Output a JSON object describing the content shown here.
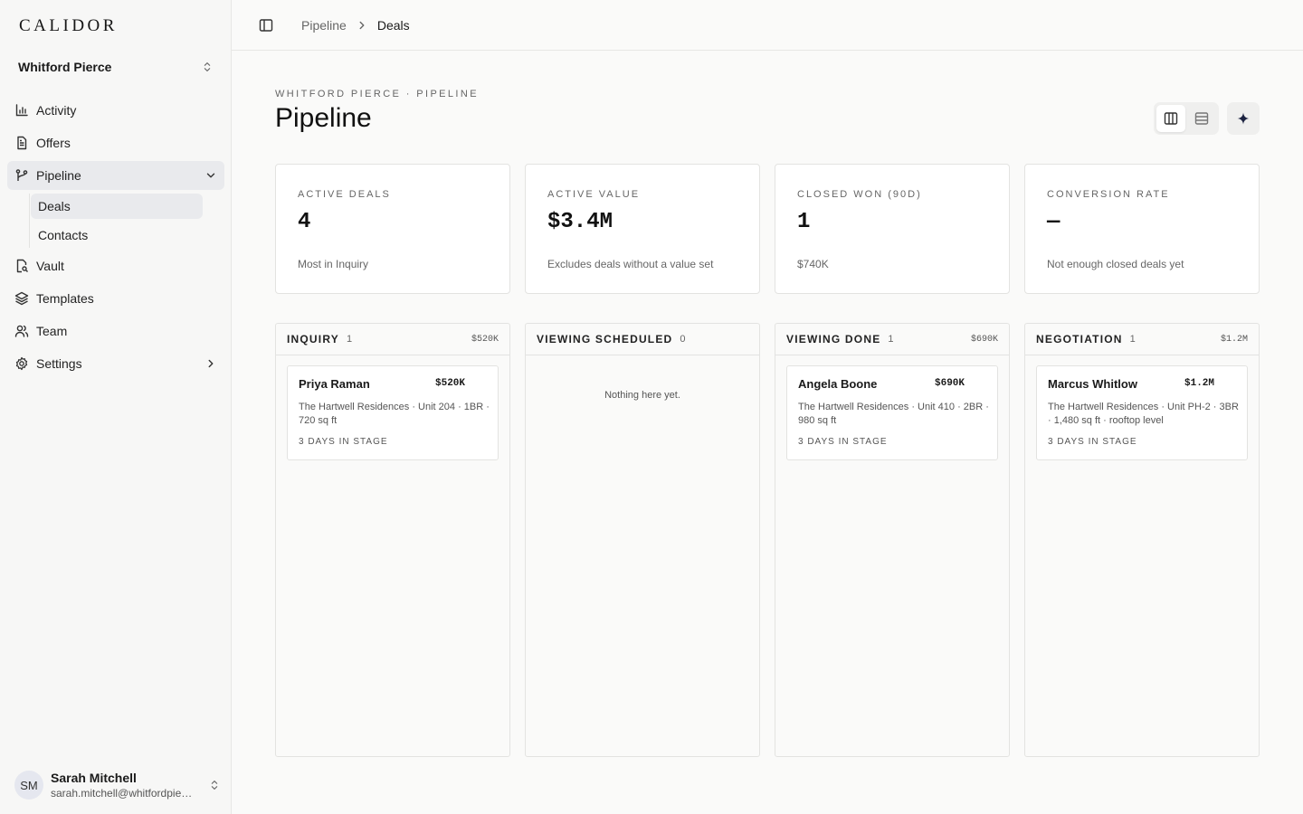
{
  "app": {
    "logo": "CALIDOR"
  },
  "sidebar": {
    "org": "Whitford Pierce",
    "items": [
      {
        "label": "Activity",
        "icon": "bar-chart-icon"
      },
      {
        "label": "Offers",
        "icon": "document-icon"
      },
      {
        "label": "Pipeline",
        "icon": "branch-icon",
        "expanded": true,
        "children": [
          {
            "label": "Deals",
            "active": true
          },
          {
            "label": "Contacts"
          }
        ]
      },
      {
        "label": "Vault",
        "icon": "file-search-icon"
      },
      {
        "label": "Templates",
        "icon": "layers-icon"
      },
      {
        "label": "Team",
        "icon": "users-icon"
      },
      {
        "label": "Settings",
        "icon": "gear-icon"
      }
    ],
    "user": {
      "initials": "SM",
      "name": "Sarah Mitchell",
      "email": "sarah.mitchell@whitfordpierce.com"
    }
  },
  "topbar": {
    "breadcrumb": [
      "Pipeline",
      "Deals"
    ]
  },
  "header": {
    "eyebrow": "WHITFORD PIERCE · PIPELINE",
    "title": "Pipeline"
  },
  "stats": [
    {
      "label": "ACTIVE DEALS",
      "value": "4",
      "note": "Most in Inquiry"
    },
    {
      "label": "ACTIVE VALUE",
      "value": "$3.4M",
      "note": "Excludes deals without a value set"
    },
    {
      "label": "CLOSED WON (90D)",
      "value": "1",
      "note": "$740K"
    },
    {
      "label": "CONVERSION RATE",
      "value": "—",
      "note": "Not enough closed deals yet"
    }
  ],
  "columns": [
    {
      "title": "INQUIRY",
      "count": "1",
      "sum": "$520K",
      "card": {
        "name": "Priya Raman",
        "value": "$520K",
        "desc": "The Hartwell Residences · Unit 204 · 1BR · 720 sq ft",
        "days": "3 DAYS IN STAGE"
      }
    },
    {
      "title": "VIEWING SCHEDULED",
      "count": "0",
      "sum": "",
      "empty": "Nothing here yet."
    },
    {
      "title": "VIEWING DONE",
      "count": "1",
      "sum": "$690K",
      "card": {
        "name": "Angela Boone",
        "value": "$690K",
        "desc": "The Hartwell Residences · Unit 410 · 2BR · 980 sq ft",
        "days": "3 DAYS IN STAGE"
      }
    },
    {
      "title": "NEGOTIATION",
      "count": "1",
      "sum": "$1.2M",
      "card": {
        "name": "Marcus Whitlow",
        "value": "$1.2M",
        "desc": "The Hartwell Residences · Unit PH-2 · 3BR · 1,480 sq ft · rooftop level",
        "days": "3 DAYS IN STAGE"
      }
    }
  ]
}
